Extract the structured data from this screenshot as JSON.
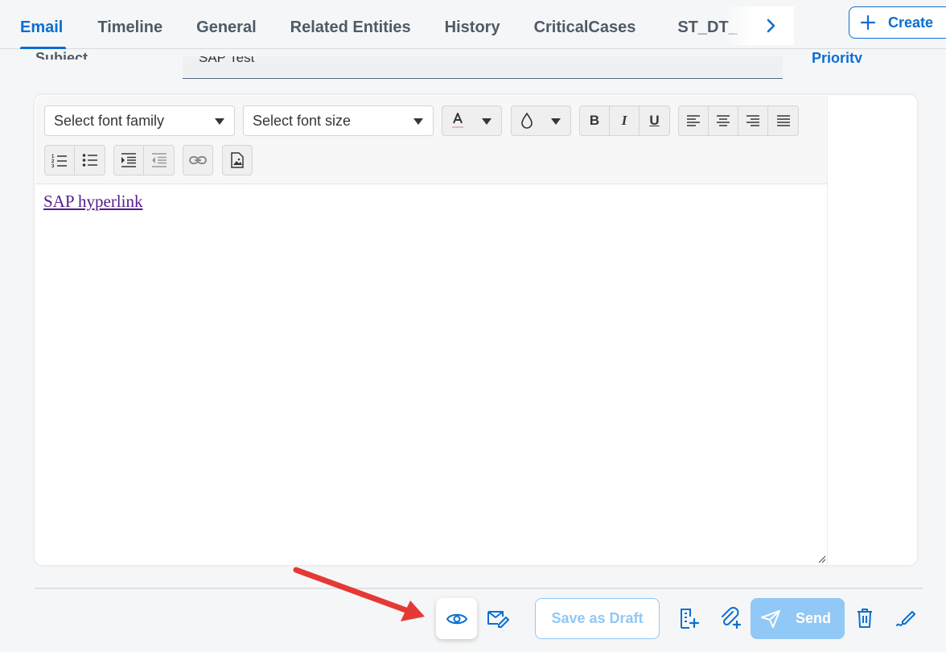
{
  "tabs": {
    "items": [
      {
        "label": "Email",
        "active": true
      },
      {
        "label": "Timeline"
      },
      {
        "label": "General"
      },
      {
        "label": "Related Entities"
      },
      {
        "label": "History"
      },
      {
        "label": "CriticalCases"
      },
      {
        "label": "ST_DT_"
      }
    ],
    "more_icon": "chevron-right-icon"
  },
  "create": {
    "label": "Create",
    "icon": "plus-icon"
  },
  "form": {
    "subject_label": "Subject",
    "subject_value": "SAP Test",
    "priority_label": "Priority"
  },
  "editor": {
    "font_family_placeholder": "Select font family",
    "font_size_placeholder": "Select font size",
    "bold_label": "B",
    "italic_label": "I",
    "underline_label": "U",
    "content_link": "SAP hyperlink"
  },
  "footer": {
    "save_draft_label": "Save as Draft",
    "send_label": "Send"
  },
  "colors": {
    "accent": "#0a6ed1",
    "disabled_accent": "#91c8f6",
    "annotation_arrow": "#e53935"
  }
}
